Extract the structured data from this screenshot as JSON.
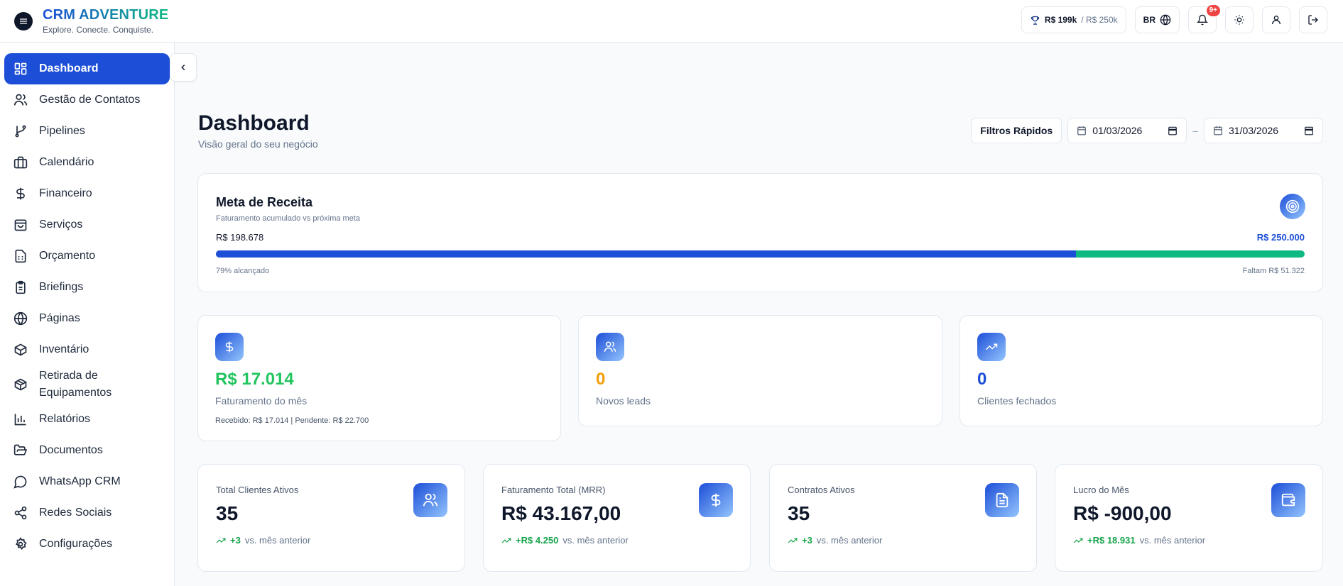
{
  "brand": {
    "name": "CRM ADVENTURE",
    "tagline": "Explore. Conecte. Conquiste."
  },
  "header": {
    "goal_current": "R$ 199k",
    "goal_target": "/ R$ 250k",
    "language": "BR",
    "notification_badge": "9+"
  },
  "sidebar": {
    "items": [
      {
        "label": "Dashboard",
        "icon": "layout-grid-icon"
      },
      {
        "label": "Gestão de Contatos",
        "icon": "users-icon"
      },
      {
        "label": "Pipelines",
        "icon": "git-branch-icon"
      },
      {
        "label": "Calendário",
        "icon": "briefcase-icon"
      },
      {
        "label": "Financeiro",
        "icon": "dollar-icon"
      },
      {
        "label": "Serviços",
        "icon": "shopping-bag-icon"
      },
      {
        "label": "Orçamento",
        "icon": "file-spreadsheet-icon"
      },
      {
        "label": "Briefings",
        "icon": "clipboard-icon"
      },
      {
        "label": "Páginas",
        "icon": "globe-icon"
      },
      {
        "label": "Inventário",
        "icon": "box-icon"
      },
      {
        "label": "Retirada de Equipamentos",
        "icon": "package-icon"
      },
      {
        "label": "Relatórios",
        "icon": "bar-chart-icon"
      },
      {
        "label": "Documentos",
        "icon": "folder-open-icon"
      },
      {
        "label": "WhatsApp CRM",
        "icon": "message-circle-icon"
      },
      {
        "label": "Redes Sociais",
        "icon": "share-icon"
      },
      {
        "label": "Configurações",
        "icon": "settings-icon"
      }
    ]
  },
  "page": {
    "title": "Dashboard",
    "subtitle": "Visão geral do seu negócio"
  },
  "filters": {
    "quick": "Filtros Rápidos",
    "start_date": "01/03/2026",
    "end_date": "31/03/2026",
    "separator": "–"
  },
  "revenue_goal": {
    "title": "Meta de Receita",
    "subtitle": "Faturamento acumulado vs próxima meta",
    "current": "R$ 198.678",
    "target": "R$ 250.000",
    "progress_percent": 79,
    "achieved_label": "79% alcançado",
    "remaining_label": "Faltam R$ 51.322"
  },
  "stats": [
    {
      "value": "R$ 17.014",
      "label": "Faturamento do mês",
      "detail": "Recebido: R$ 17.014 | Pendente: R$ 22.700",
      "color": "#22c55e",
      "icon": "dollar-icon"
    },
    {
      "value": "0",
      "label": "Novos leads",
      "detail": "",
      "color": "#f59e0b",
      "icon": "users-icon"
    },
    {
      "value": "0",
      "label": "Clientes fechados",
      "detail": "",
      "color": "#1d4ed8",
      "icon": "trending-up-icon"
    }
  ],
  "kpis": [
    {
      "label": "Total Clientes Ativos",
      "value": "35",
      "delta": "+3",
      "suffix": "vs. mês anterior",
      "icon": "users-icon"
    },
    {
      "label": "Faturamento Total (MRR)",
      "value": "R$ 43.167,00",
      "delta": "+R$ 4.250",
      "suffix": "vs. mês anterior",
      "icon": "dollar-icon"
    },
    {
      "label": "Contratos Ativos",
      "value": "35",
      "delta": "+3",
      "suffix": "vs. mês anterior",
      "icon": "file-text-icon"
    },
    {
      "label": "Lucro do Mês",
      "value": "R$ -900,00",
      "delta": "+R$ 18.931",
      "suffix": "vs. mês anterior",
      "icon": "wallet-icon"
    }
  ],
  "colors": {
    "primary": "#1d4ed8",
    "success": "#10b981",
    "warning": "#f59e0b"
  }
}
